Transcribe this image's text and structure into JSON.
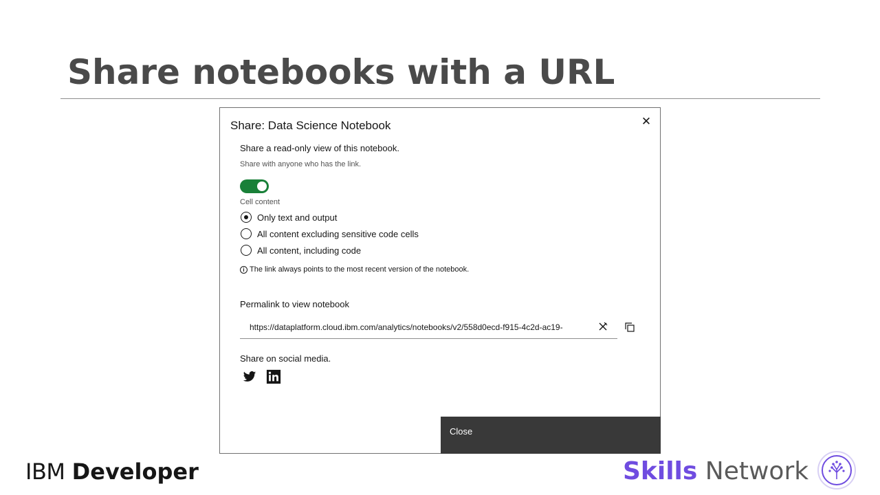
{
  "slide": {
    "title": "Share notebooks with a URL"
  },
  "modal": {
    "heading": "Share: Data Science Notebook",
    "close_icon": "close-icon",
    "description": "Share a read-only view of this notebook.",
    "helper": "Share with anyone who has the link.",
    "toggle_on": true,
    "toggle_color": "#198038",
    "cell_content_label": "Cell content",
    "options": [
      {
        "label": "Only text and output",
        "selected": true
      },
      {
        "label": "All content excluding sensitive code cells",
        "selected": false
      },
      {
        "label": "All content, including code",
        "selected": false
      }
    ],
    "note": "The link always points to the most recent version of the notebook.",
    "permalink_label": "Permalink to view notebook",
    "permalink_url": "https://dataplatform.cloud.ibm.com/analytics/notebooks/v2/558d0ecd-f915-4c2d-ac19-",
    "social_label": "Share on social media.",
    "social_icons": [
      "twitter-icon",
      "linkedin-icon"
    ],
    "close_button": "Close",
    "close_button_color": "#393939"
  },
  "footer": {
    "ibm_light": "IBM",
    "ibm_bold": "Developer",
    "skills_1": "Skills",
    "skills_2": "Network",
    "skills_color": "#6f4ce0"
  }
}
